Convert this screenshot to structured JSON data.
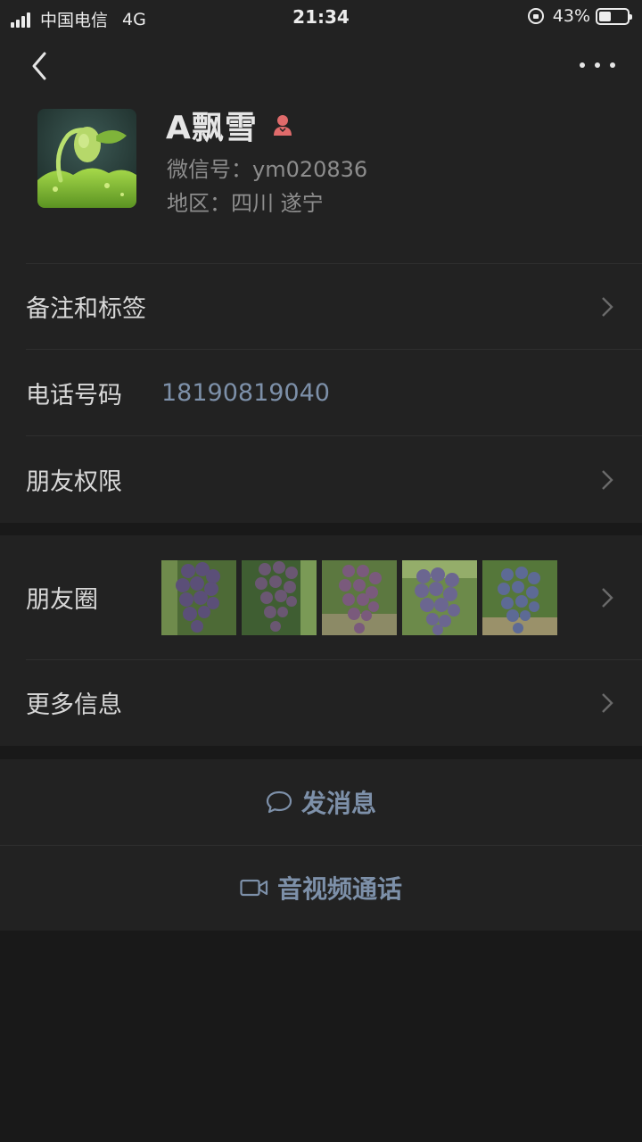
{
  "status_bar": {
    "carrier": "中国电信",
    "network": "4G",
    "time": "21:34",
    "battery_percent_text": "43%",
    "battery_level": 0.43
  },
  "header": {
    "back_icon": "chevron-left-icon",
    "more_icon": "more-dots-icon"
  },
  "profile": {
    "name": "A飘雪",
    "gender_icon": "female-icon",
    "gender_color": "#e06b6b",
    "wechat_id": "微信号：ym020836",
    "region": "地区：四川 遂宁"
  },
  "menu": {
    "remarks_tags": "备注和标签",
    "phone_label": "电话号码",
    "phone_value": "18190819040",
    "friend_permissions": "朋友权限",
    "moments": "朋友圈",
    "more_info": "更多信息"
  },
  "actions": {
    "send_message": "发消息",
    "video_call": "音视频通话"
  },
  "colors": {
    "background": "#191919",
    "card": "#222222",
    "link_blue": "#7d90a9"
  }
}
